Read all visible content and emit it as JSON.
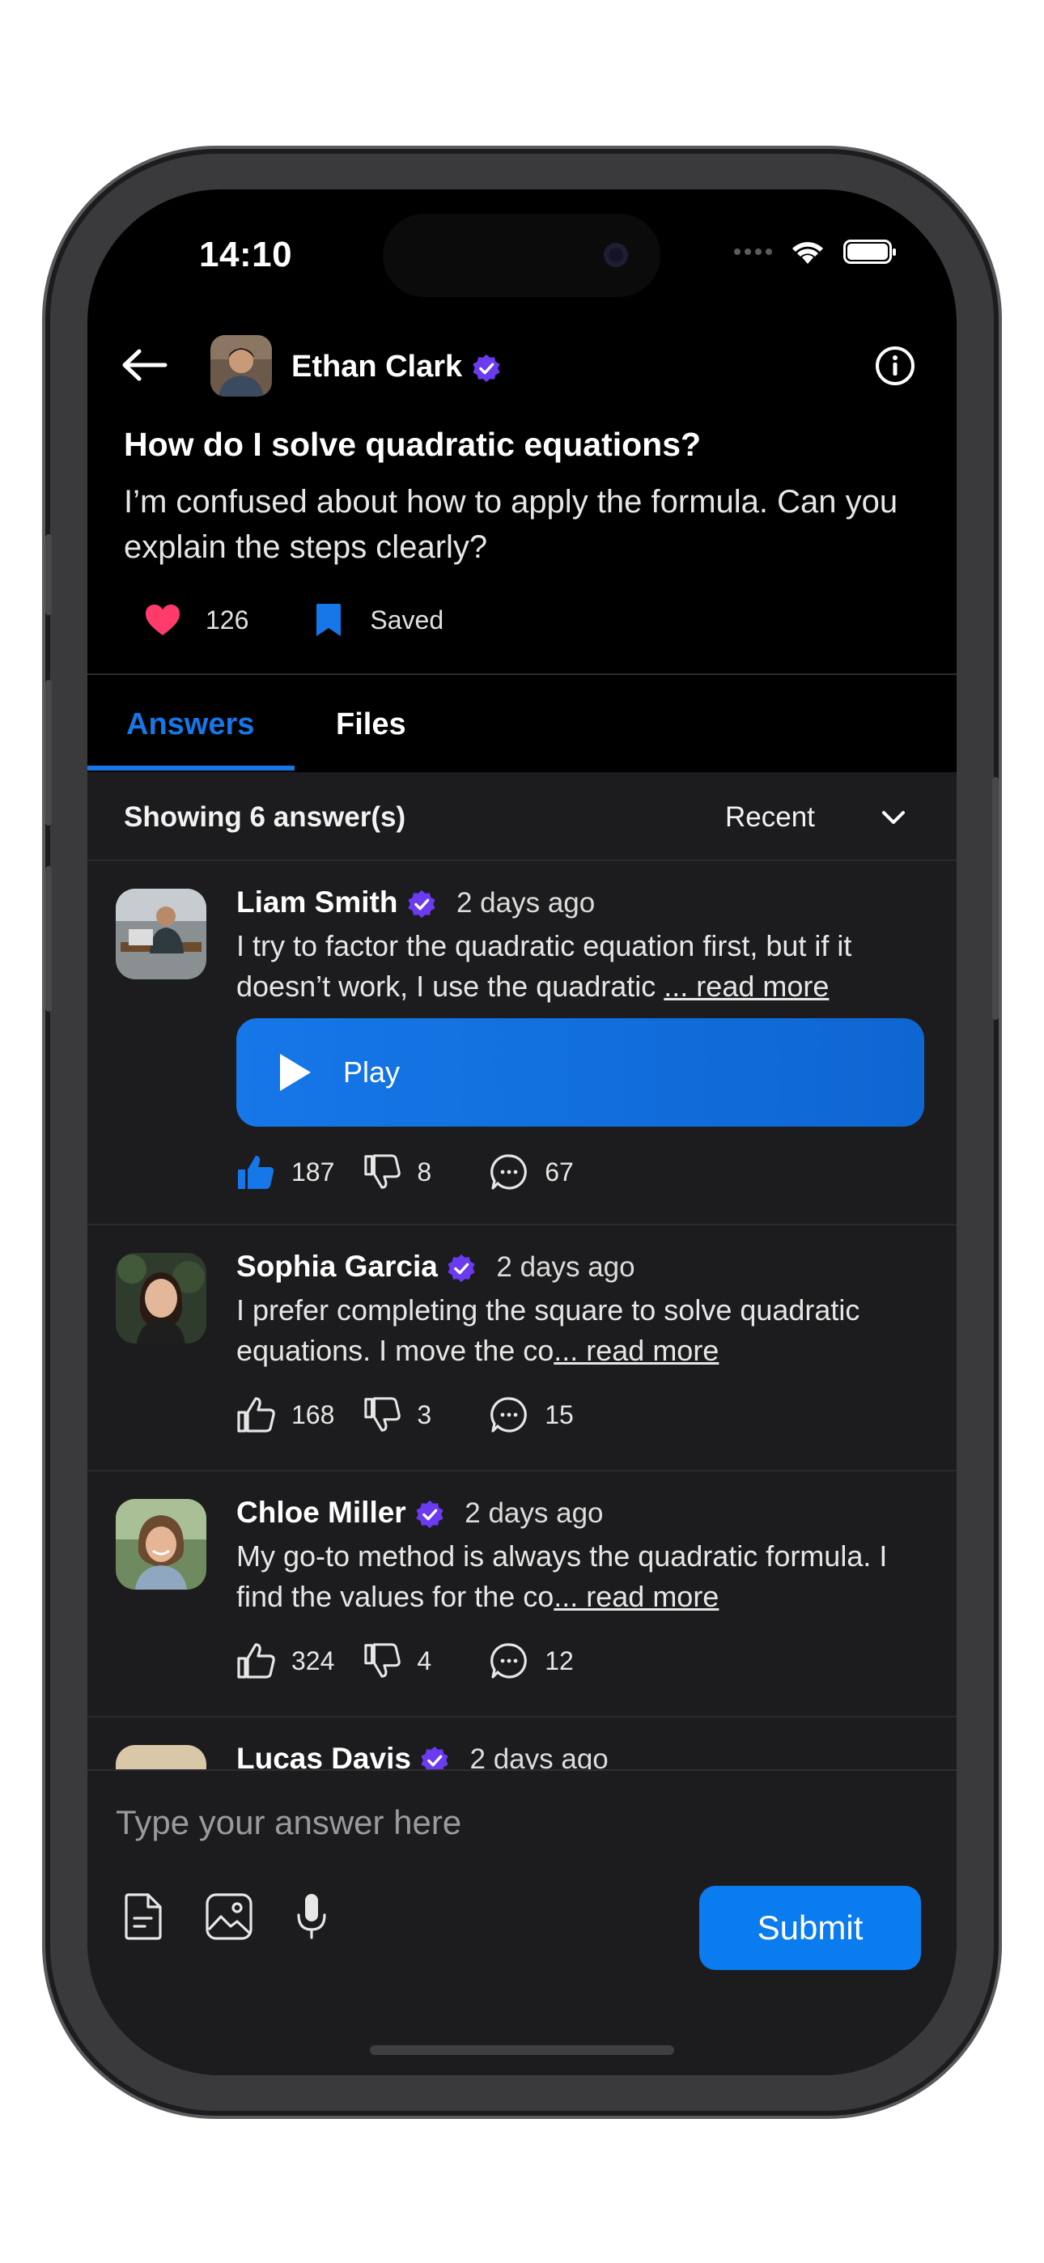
{
  "status_bar": {
    "time": "14:10"
  },
  "header": {
    "user_name": "Ethan Clark"
  },
  "question": {
    "title": "How do I solve quadratic equations?",
    "body": "I’m confused about how to apply the formula. Can you explain the steps clearly?",
    "likes": "126",
    "saved_label": "Saved"
  },
  "tabs": [
    {
      "label": "Answers",
      "active": true
    },
    {
      "label": "Files",
      "active": false
    }
  ],
  "answers_header": {
    "showing": "Showing 6 answer(s)",
    "sort": "Recent"
  },
  "answers": [
    {
      "name": "Liam  Smith",
      "time": "2 days ago",
      "text": "I try to factor the quadratic equation first, but if it doesn’t work, I use the quadratic ",
      "read_more": "... read more",
      "play_label": "Play",
      "likes": "187",
      "dislikes": "8",
      "comments": "67",
      "liked": true
    },
    {
      "name": "Sophia Garcia",
      "time": "2 days ago",
      "text": "I prefer completing the square to solve quadratic equations. I move the co",
      "read_more": "... read more",
      "likes": "168",
      "dislikes": "3",
      "comments": "15",
      "liked": false
    },
    {
      "name": "Chloe Miller",
      "time": "2 days ago",
      "text": "My go-to method is always the quadratic formula. I find the values for the co",
      "read_more": "... read more",
      "likes": "324",
      "dislikes": "4",
      "comments": "12",
      "liked": false
    },
    {
      "name": "Lucas Davis",
      "time": "2 days ago"
    }
  ],
  "composer": {
    "placeholder": "Type your answer here",
    "submit_label": "Submit"
  },
  "colors": {
    "accent": "#1677e8",
    "heart": "#ff3b6b",
    "verified": "#6a3bf0",
    "surface": "#1c1c1e"
  }
}
